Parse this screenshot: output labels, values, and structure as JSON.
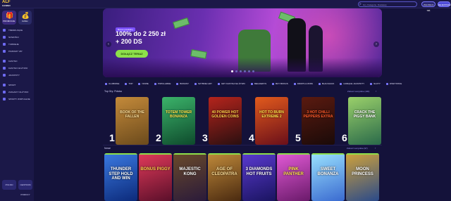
{
  "header": {
    "logo_main": "ALF",
    "logo_sub": "CASINO",
    "search_placeholder": "Gry, Kategorie, Dostawcy",
    "login": "ZALOGUJ SIĘ",
    "register": "REJESTRACJA"
  },
  "sidebar": {
    "tiles": [
      {
        "label": "PROMOCJE",
        "icon": "gift-icon"
      },
      {
        "label": "CASH",
        "icon": "wallet-icon"
      }
    ],
    "items": [
      {
        "label": "TRENDUJĄCE",
        "icon": "fire-icon"
      },
      {
        "label": "NOWOŚCI",
        "icon": "star-icon"
      },
      {
        "label": "TURNIEJE",
        "icon": "trophy-icon"
      },
      {
        "label": "POZIOMY VIP",
        "icon": "crown-icon"
      },
      {
        "label": "KASYNO",
        "icon": "slot-icon"
      },
      {
        "label": "KASYNO NA ŻYWO",
        "icon": "live-icon"
      },
      {
        "label": "JACKPOTY",
        "icon": "jackpot-icon"
      },
      {
        "label": "SPORT",
        "icon": "ball-icon"
      },
      {
        "label": "ZAKŁADY NA ŻYWO",
        "icon": "live-bet-icon"
      },
      {
        "label": "SPORTY WIRTUALNE",
        "icon": "virtual-icon"
      }
    ],
    "bottom": [
      "POLSKI",
      "CENTRUM POMOCY"
    ]
  },
  "hero": {
    "badge": "Bonus powitalny",
    "line1": "100% do 2 250 zł",
    "line2": "+ 200 DS",
    "cta": "DOŁĄCZ TERAZ",
    "dots": 6,
    "active_dot": 0
  },
  "categories": [
    "ULUBIONE",
    "TOP",
    "NOWE",
    "POPULARNE",
    "BONUSY",
    "SZYBKIE GRY",
    "GRY KASYNA NA ŻYWO",
    "MEGAWAYS",
    "BUY BONUS",
    "DROPS & WINS",
    "BLACKJACK",
    "GORĄCE JACKPOTY",
    "SLOTY",
    "WSZYSTKIE"
  ],
  "top_games": {
    "title": "Top Gry: Polska",
    "link": "Zobacz wszystkie (100)",
    "games": [
      {
        "rank": "1",
        "title": "BOOK OF THE FALLEN",
        "bg": "#6b4a1c",
        "bg2": "#c48a3a",
        "fg": "#ffe09a"
      },
      {
        "rank": "2",
        "title": "TOTEM TOWER BONANZA",
        "bg": "#0e4a2c",
        "bg2": "#3bb36a",
        "fg": "#ffe24a"
      },
      {
        "rank": "3",
        "title": "40 POWER HOT GOLDEN COINS",
        "bg": "#2a0f10",
        "bg2": "#b5241c",
        "fg": "#ffd24a"
      },
      {
        "rank": "4",
        "title": "HOT TO BURN EXTREME 2",
        "bg": "#6a0f1a",
        "bg2": "#e25a1c",
        "fg": "#ffe14a"
      },
      {
        "rank": "5",
        "title": "3 HOT CHILLI PEPPERS EXTRA",
        "bg": "#1a0a08",
        "bg2": "#5a1a10",
        "fg": "#ff5a2a"
      },
      {
        "rank": "6",
        "title": "CRACK THE PIGGY BANK",
        "bg": "#2a6a4a",
        "bg2": "#9ad06a",
        "fg": "#ffffff"
      }
    ]
  },
  "new_games": {
    "title": "Nowe",
    "link": "Zobacz wszystkie (97)",
    "games": [
      {
        "title": "THUNDER STEP HOLD AND WIN",
        "bg": "#0c2a7a",
        "bg2": "#3a7ae2",
        "fg": "#ffffff"
      },
      {
        "title": "BONUS PIGGY",
        "bg": "#5a0f2a",
        "bg2": "#e23a5a",
        "fg": "#ffd24a"
      },
      {
        "title": "MAJESTIC KONG",
        "bg": "#2a1a3a",
        "bg2": "#6a4a2a",
        "fg": "#ffffff"
      },
      {
        "title": "AGE OF CLEOPATRA",
        "bg": "#4a2a10",
        "bg2": "#c08a3a",
        "fg": "#ffe09a"
      },
      {
        "title": "3 DIAMONDS HOT FRUITS",
        "bg": "#1a1460",
        "bg2": "#5a3ad0",
        "fg": "#ffffff"
      },
      {
        "title": "PINK PANTHER",
        "bg": "#6a1a6a",
        "bg2": "#e25ad6",
        "fg": "#ffe24a"
      },
      {
        "title": "SWEET BONANZA",
        "bg": "#3a6ad0",
        "bg2": "#9ae2ff",
        "fg": "#ffffff"
      },
      {
        "title": "MOON PRINCESS",
        "bg": "#2a4a8a",
        "bg2": "#d0a23a",
        "fg": "#ffffff"
      }
    ]
  }
}
